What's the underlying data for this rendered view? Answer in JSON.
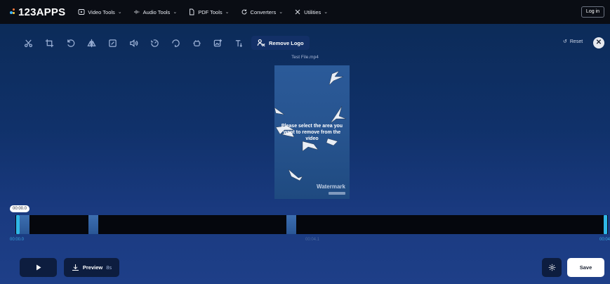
{
  "brand": {
    "name": "123APPS"
  },
  "nav": [
    {
      "label": "Video Tools",
      "icon": "video-icon"
    },
    {
      "label": "Audio Tools",
      "icon": "audio-wave-icon"
    },
    {
      "label": "PDF Tools",
      "icon": "document-icon"
    },
    {
      "label": "Converters",
      "icon": "refresh-icon"
    },
    {
      "label": "Utilities",
      "icon": "tools-icon"
    }
  ],
  "login_label": "Log in",
  "toolbar": {
    "tools": [
      "scissors-icon",
      "crop-icon",
      "rotate-icon",
      "flip-icon",
      "resize-icon",
      "volume-icon",
      "speed-icon",
      "loop-icon",
      "stabilize-icon",
      "image-icon",
      "text-icon"
    ],
    "active_label": "Remove Logo",
    "active_icon": "remove-logo-icon",
    "reset_label": "Reset"
  },
  "video": {
    "filename": "Test File.mp4",
    "message": "Please select the area you want to remove from the video",
    "watermark_text": "Watermark"
  },
  "timeline": {
    "current_badge": "00:00.0",
    "start_time": "00:00.0",
    "mid_time": "00:04.1",
    "end_time": "00:04"
  },
  "controls": {
    "preview_label": "Preview",
    "preview_duration": "8s",
    "save_label": "Save"
  },
  "colors": {
    "accent": "#2fb7e6",
    "background": "#10316a",
    "topbar": "#0a0d14"
  }
}
